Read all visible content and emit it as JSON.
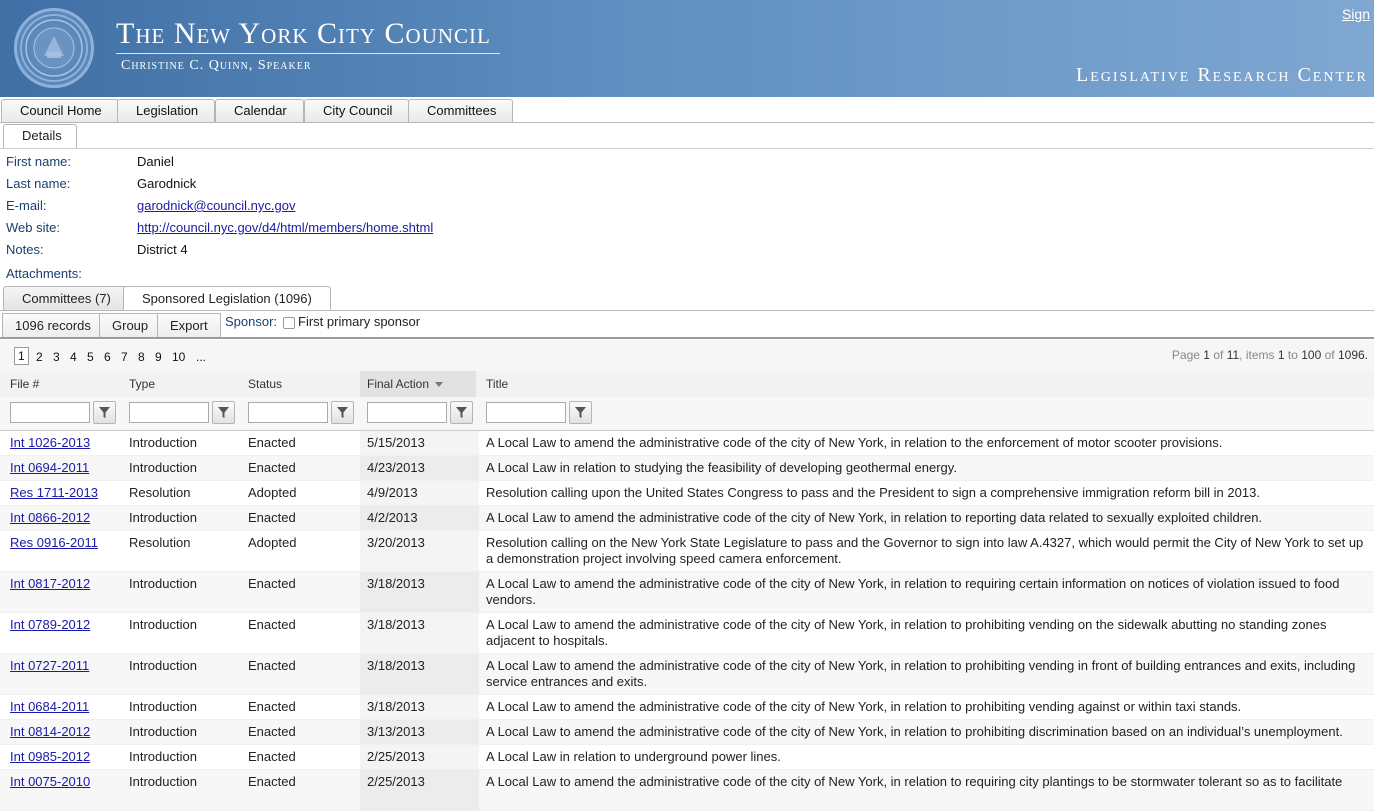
{
  "header": {
    "title": "The New York City Council",
    "subtitle": "Christine C. Quinn, Speaker",
    "sign_link": "Sign",
    "section": "Legislative Research Center"
  },
  "nav": {
    "tabs": [
      "Council Home",
      "Legislation",
      "Calendar",
      "City Council",
      "Committees"
    ],
    "subtab": "Details"
  },
  "details": {
    "first_name_label": "First name:",
    "first_name": "Daniel",
    "last_name_label": "Last name:",
    "last_name": "Garodnick",
    "email_label": "E-mail:",
    "email": "garodnick@council.nyc.gov",
    "website_label": "Web site:",
    "website": "http://council.nyc.gov/d4/html/members/home.shtml",
    "notes_label": "Notes:",
    "notes": "District 4",
    "attachments_label": "Attachments:"
  },
  "panel_tabs": [
    "Committees (7)",
    "Sponsored Legislation (1096)"
  ],
  "toolbar": {
    "records": "1096 records",
    "group": "Group",
    "export": "Export",
    "sponsor_label": "Sponsor:",
    "first_primary": "First primary sponsor"
  },
  "pager": {
    "pages": [
      "1",
      "2",
      "3",
      "4",
      "5",
      "6",
      "7",
      "8",
      "9",
      "10",
      "..."
    ],
    "info_page_label": "Page",
    "info_page": "1",
    "info_of": "of",
    "info_total_pages": "11",
    "info_items_label": ", items",
    "info_from": "1",
    "info_to_label": "to",
    "info_to": "100",
    "info_of2": "of",
    "info_total": "1096."
  },
  "columns": [
    "File #",
    "Type",
    "Status",
    "Final Action",
    "Title"
  ],
  "rows": [
    {
      "file": "Int 1026-2013",
      "type": "Introduction",
      "status": "Enacted",
      "final": "5/15/2013",
      "title": "A Local Law to amend the administrative code of the city of New York, in relation to the enforcement of motor scooter provisions."
    },
    {
      "file": "Int 0694-2011",
      "type": "Introduction",
      "status": "Enacted",
      "final": "4/23/2013",
      "title": "A Local Law in relation to studying the feasibility of developing geothermal energy."
    },
    {
      "file": "Res 1711-2013",
      "type": "Resolution",
      "status": "Adopted",
      "final": "4/9/2013",
      "title": "Resolution calling upon the United States Congress to pass and the President to sign a comprehensive immigration reform bill in 2013."
    },
    {
      "file": "Int 0866-2012",
      "type": "Introduction",
      "status": "Enacted",
      "final": "4/2/2013",
      "title": "A Local Law to amend the administrative code of the city of New York, in relation to reporting data related to sexually exploited children."
    },
    {
      "file": "Res 0916-2011",
      "type": "Resolution",
      "status": "Adopted",
      "final": "3/20/2013",
      "title": "Resolution calling on the New York State Legislature to pass and the Governor to sign into law A.4327, which would permit the City of New York to set up a demonstration project involving speed camera enforcement."
    },
    {
      "file": "Int 0817-2012",
      "type": "Introduction",
      "status": "Enacted",
      "final": "3/18/2013",
      "title": "A Local Law to amend the administrative code of the city of New York, in relation to requiring certain information on notices of violation issued to food vendors."
    },
    {
      "file": "Int 0789-2012",
      "type": "Introduction",
      "status": "Enacted",
      "final": "3/18/2013",
      "title": "A Local Law to amend the administrative code of the city of New York, in relation to prohibiting vending on the sidewalk abutting no standing zones adjacent to hospitals."
    },
    {
      "file": "Int 0727-2011",
      "type": "Introduction",
      "status": "Enacted",
      "final": "3/18/2013",
      "title": "A Local Law to amend the administrative code of the city of New York, in relation to prohibiting vending in front of building entrances and exits, including service entrances and exits."
    },
    {
      "file": "Int 0684-2011",
      "type": "Introduction",
      "status": "Enacted",
      "final": "3/18/2013",
      "title": "A Local Law to amend the administrative code of the city of New York, in relation to prohibiting vending against or within taxi stands."
    },
    {
      "file": "Int 0814-2012",
      "type": "Introduction",
      "status": "Enacted",
      "final": "3/13/2013",
      "title": "A Local Law to amend the administrative code of the city of New York, in relation to prohibiting discrimination based on an individual’s unemployment."
    },
    {
      "file": "Int 0985-2012",
      "type": "Introduction",
      "status": "Enacted",
      "final": "2/25/2013",
      "title": "A Local Law in relation to underground power lines."
    },
    {
      "file": "Int 0075-2010",
      "type": "Introduction",
      "status": "Enacted",
      "final": "2/25/2013",
      "title": "A Local Law to amend the administrative code of the city of New York, in relation to requiring city plantings to be stormwater tolerant so as to facilitate"
    }
  ]
}
